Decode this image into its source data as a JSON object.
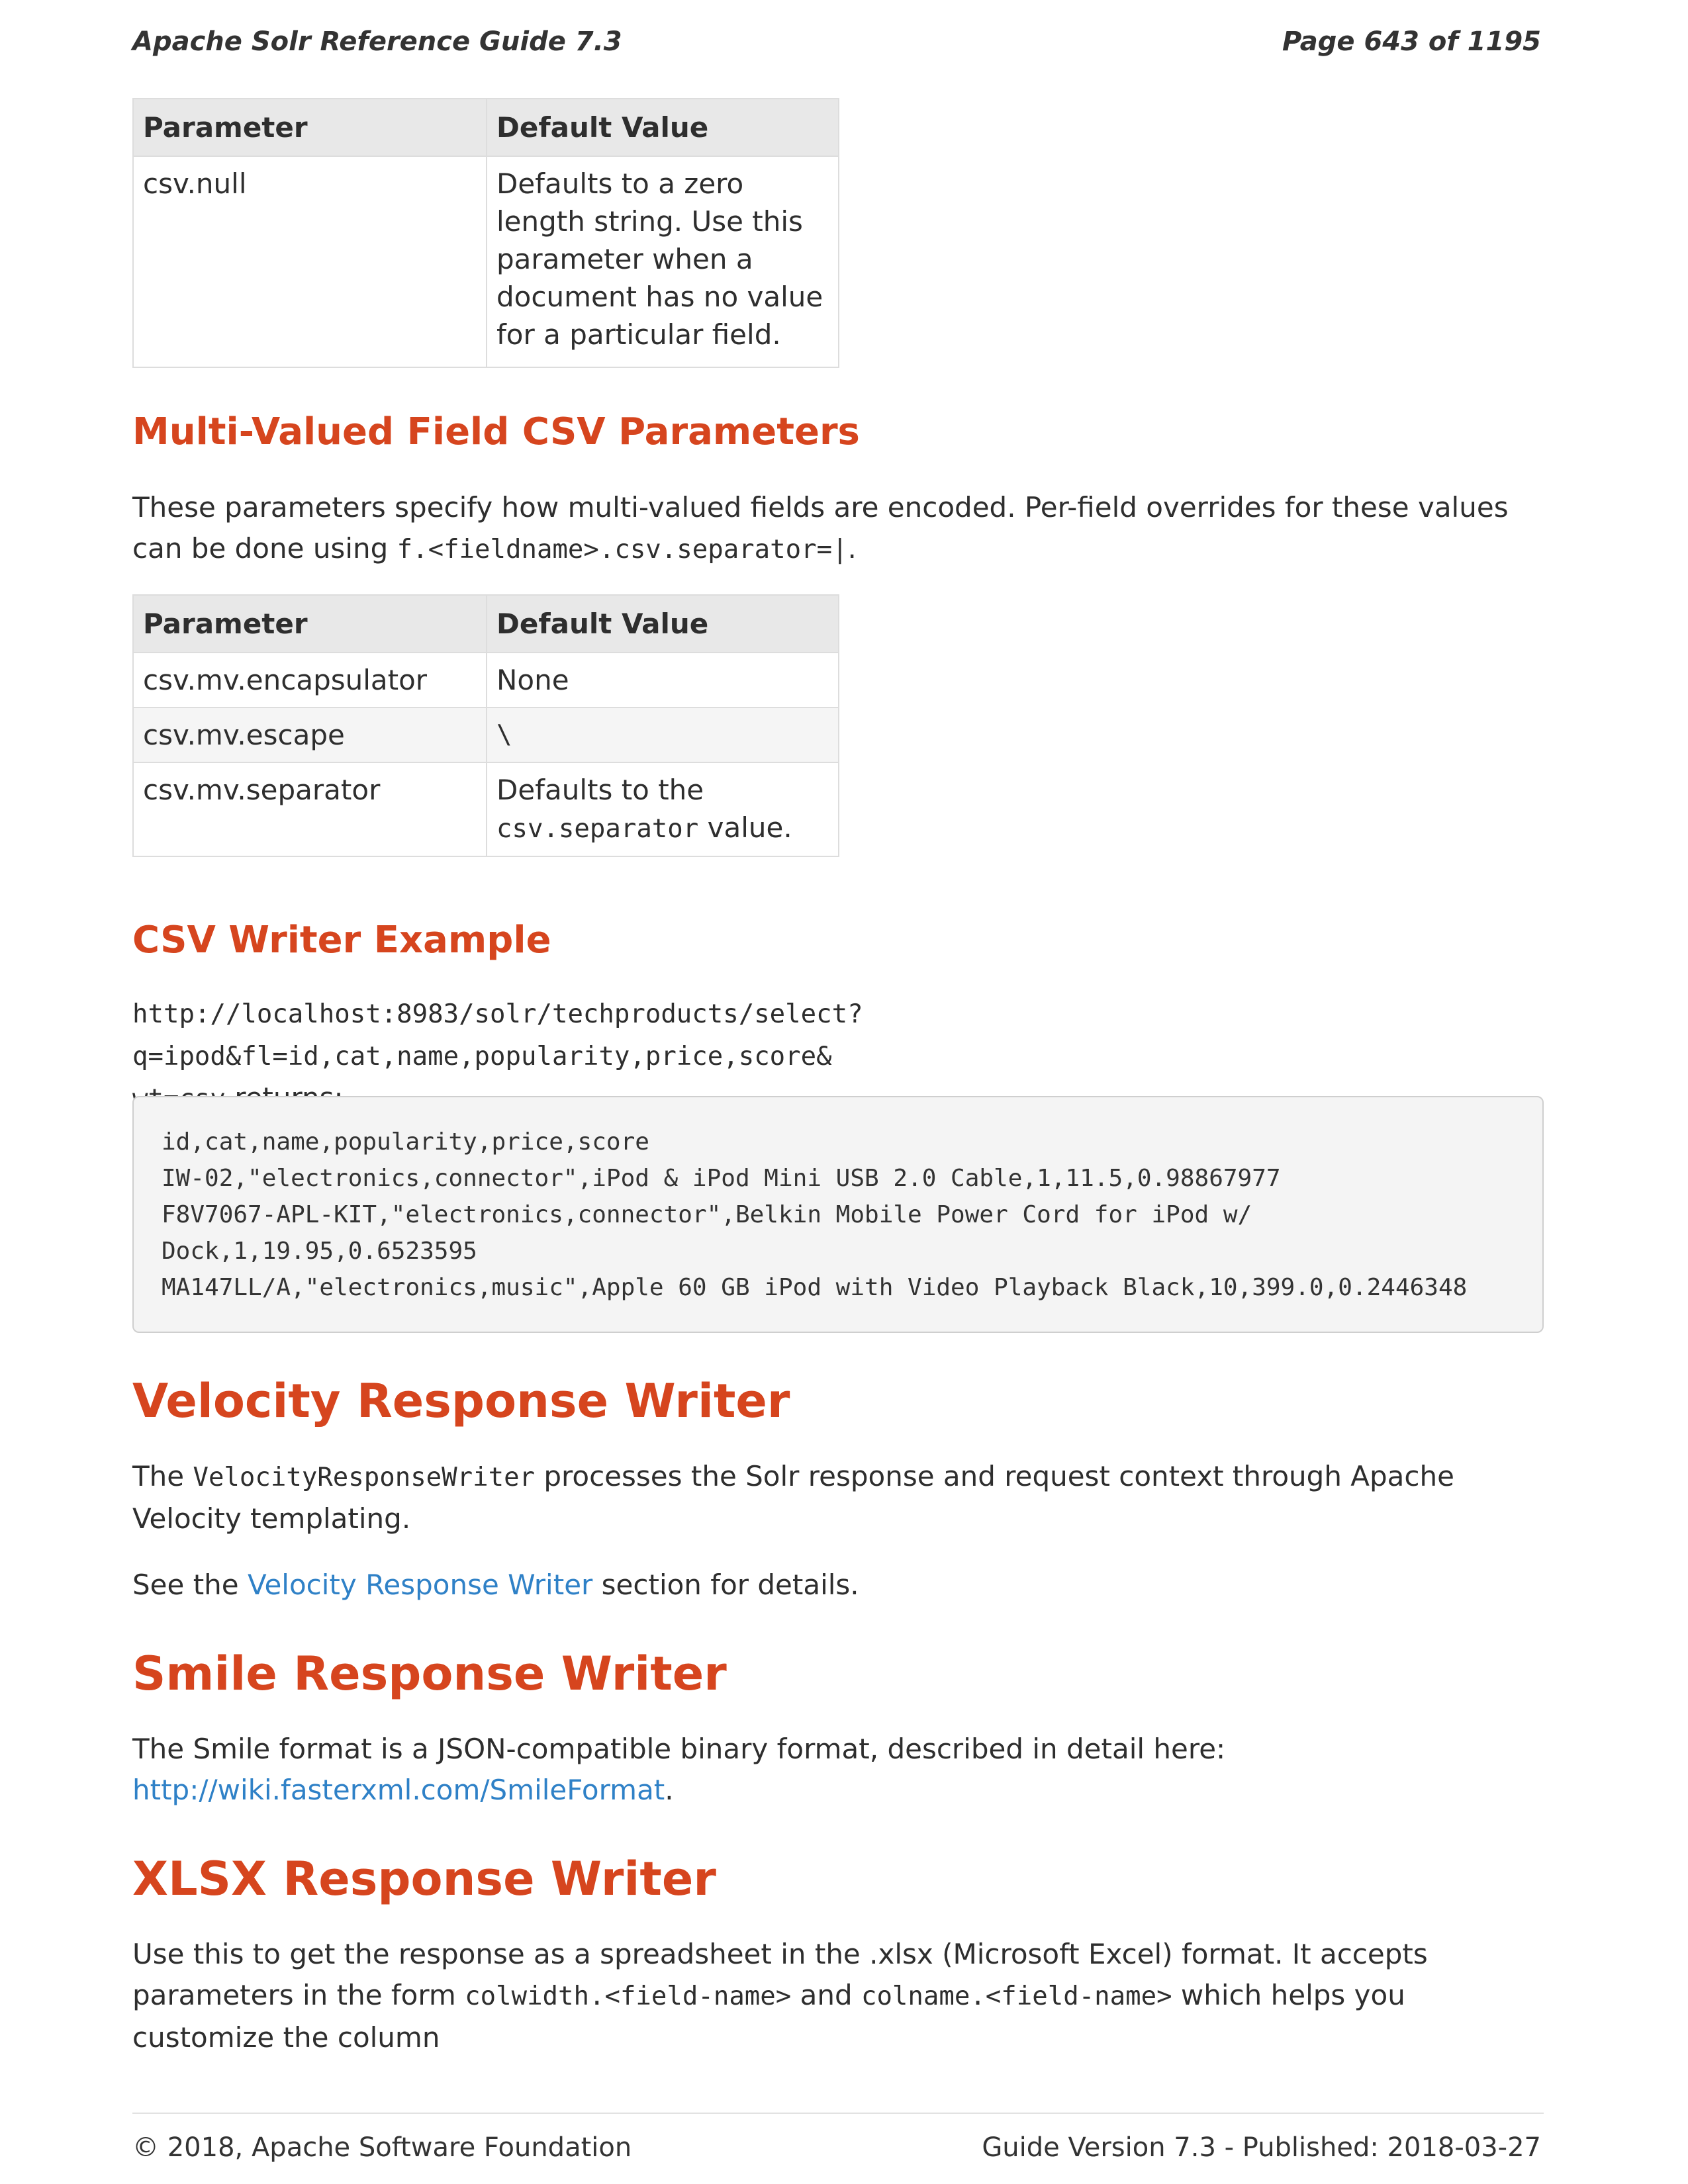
{
  "header": {
    "title": "Apache Solr Reference Guide 7.3",
    "page": "Page 643 of 1195"
  },
  "table1": {
    "headers": [
      "Parameter",
      "Default Value"
    ],
    "rows": [
      {
        "param": "csv.null",
        "value": "Defaults to a zero length string. Use this parameter when a document has no value for a particular field."
      }
    ]
  },
  "multi": {
    "heading": "Multi-Valued Field CSV Parameters",
    "intro_a": "These parameters specify how multi-valued fields are encoded. Per-field overrides for these values can be done using ",
    "intro_code": "f.<fieldname>.csv.separator=|",
    "intro_b": "."
  },
  "table2": {
    "headers": [
      "Parameter",
      "Default Value"
    ],
    "rows": [
      {
        "param": "csv.mv.encapsulator",
        "value": "None"
      },
      {
        "param": "csv.mv.escape",
        "value": "\\"
      },
      {
        "param": "csv.mv.separator",
        "value_a": "Defaults to the ",
        "value_code": "csv.separator",
        "value_b": " value."
      }
    ]
  },
  "csv_example": {
    "heading": "CSV Writer Example",
    "url": "http://localhost:8983/solr/techproducts/select?q=ipod&fl=id,cat,name,popularity,price,score&",
    "url2": "wt=csv",
    "returns": " returns:",
    "code_lines": [
      "id,cat,name,popularity,price,score",
      "IW-02,\"electronics,connector\",iPod & iPod Mini USB 2.0 Cable,1,11.5,0.98867977",
      "F8V7067-APL-KIT,\"electronics,connector\",Belkin Mobile Power Cord for iPod w/",
      "Dock,1,19.95,0.6523595",
      "MA147LL/A,\"electronics,music\",Apple 60 GB iPod with Video Playback Black,10,399.0,0.2446348"
    ]
  },
  "velocity": {
    "heading": "Velocity Response Writer",
    "p1_a": "The ",
    "p1_code": "VelocityResponseWriter",
    "p1_b": " processes the Solr response and request context through Apache Velocity templating.",
    "p2_a": "See the ",
    "p2_link": "Velocity Response Writer",
    "p2_b": " section for details."
  },
  "smile": {
    "heading": "Smile Response Writer",
    "p_a": "The Smile format is a JSON-compatible binary format, described in detail here: ",
    "p_link": "http://wiki.fasterxml.com/SmileFormat",
    "p_b": "."
  },
  "xlsx": {
    "heading": "XLSX Response Writer",
    "p_a": "Use this to get the response as a spreadsheet in the .xlsx (Microsoft Excel) format. It accepts parameters in the form ",
    "p_code1": "colwidth.<field-name>",
    "p_mid": " and ",
    "p_code2": "colname.<field-name>",
    "p_b": " which helps you customize the column"
  },
  "footer": {
    "left": "© 2018, Apache Software Foundation",
    "right": "Guide Version 7.3 - Published: 2018-03-27"
  }
}
